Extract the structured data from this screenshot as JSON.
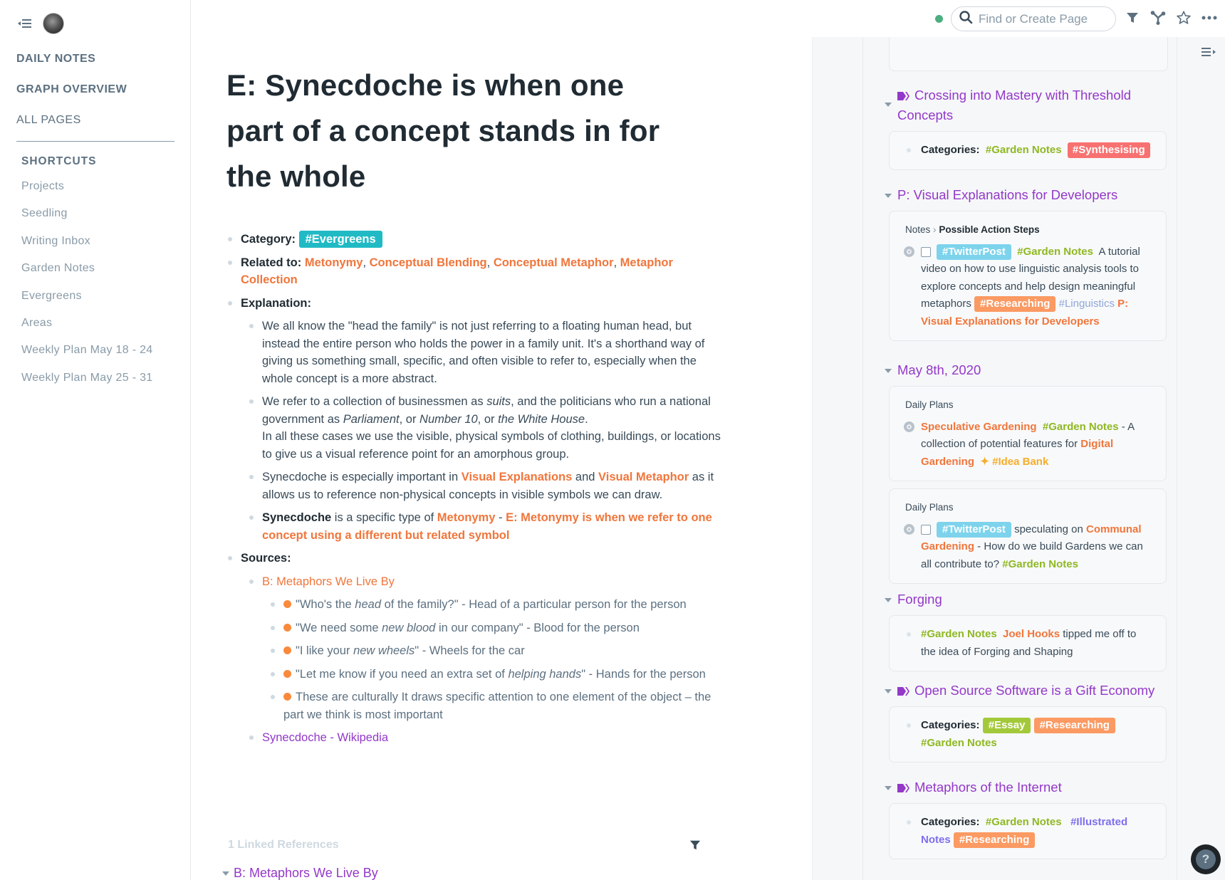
{
  "sidebar": {
    "nav": [
      "DAILY NOTES",
      "GRAPH OVERVIEW",
      "ALL PAGES"
    ],
    "shortcuts_header": "SHORTCUTS",
    "shortcuts": [
      "Projects",
      "Seedling",
      "Writing Inbox",
      "Garden Notes",
      "Evergreens",
      "Areas",
      "Weekly Plan May 18 - 24",
      "Weekly Plan May 25 - 31"
    ]
  },
  "topbar": {
    "search_placeholder": "Find or Create Page",
    "icons": [
      "filter-icon",
      "graph-icon",
      "star-icon",
      "more-icon"
    ]
  },
  "page": {
    "title": "E: Synecdoche is when one part of a concept stands in for the whole",
    "category_label": "Category:",
    "category_tag": "#Evergreens",
    "related_label": "Related to:",
    "related": [
      "Metonymy",
      "Conceptual Blending",
      "Conceptual Metaphor",
      "Metaphor Collection"
    ],
    "explanation_label": "Explanation:",
    "exp1": "We all know the \"head the family\" is not just referring to a floating human head, but instead the entire person who holds the power in a family unit. It's a shorthand way of giving us something small, specific, and often visible to refer to, especially when the whole concept is a more abstract.",
    "exp2": {
      "a": "We refer to a collection of businessmen as ",
      "b": "suits",
      "c": ", and the politicians who run a national government as ",
      "d": "Parliament",
      "e": ", or ",
      "f": "Number 10",
      "g": ", or ",
      "h": "the White House",
      "i": ".",
      "j": "In all these cases we use the visible, physical symbols of clothing, buildings, or locations to give us a visual reference point for an amorphous group."
    },
    "exp3": {
      "a": "Synecdoche is especially important in ",
      "link1": "Visual Explanations",
      "b": " and ",
      "link2": "Visual Metaphor",
      "c": " as it allows us to reference non-physical concepts in visible symbols we can draw."
    },
    "exp4": {
      "bold": "Synecdoche",
      "a": " is a specific type of ",
      "link1": "Metonymy",
      "b": " - ",
      "link2": "E: Metonymy is when we refer to one concept using a different but related symbol"
    },
    "sources_label": "Sources:",
    "source_link": "B: Metaphors We Live By",
    "examples": [
      {
        "a": "\"Who's the ",
        "i": "head",
        "b": " of the family?\" - Head of a particular person for the person"
      },
      {
        "a": "\"We need some ",
        "i": "new blood",
        "b": " in our company\" - Blood for the person"
      },
      {
        "a": "\"I like your ",
        "i": "new wheels",
        "b": "\" - Wheels for the car"
      },
      {
        "a": "\"Let me know if you need an extra set of ",
        "i": "helping hands",
        "b": "\" - Hands for the person"
      },
      {
        "a": "These are culturally It draws specific attention to one element of the object – the part we think is most important",
        "i": "",
        "b": ""
      }
    ],
    "wiki_link": "Synecdoche - Wikipedia",
    "linked_refs": "1 Linked References",
    "linked_ref_item": "B: Metaphors We Live By"
  },
  "right_panel": {
    "s1": {
      "title": "Crossing into Mastery with Threshold Concepts",
      "label": "Categories:",
      "tag1": "#Garden Notes",
      "tag2": "#Synthesising"
    },
    "s2": {
      "title": "P: Visual Explanations for Developers",
      "crumb1": "Notes",
      "crumb2": "Possible Action Steps",
      "tag_twitter": "#TwitterPost",
      "tag_garden": "#Garden Notes",
      "text": "A tutorial video on how to use linguistic analysis tools to explore concepts and help design meaningful metaphors",
      "tag_research": "#Researching",
      "tag_ling": "#Linguistics",
      "link": "P: Visual Explanations for Developers"
    },
    "s3": {
      "title": "May 8th, 2020",
      "card1": {
        "crumb": "Daily Plans",
        "link1": "Speculative Gardening",
        "tag": "#Garden Notes",
        "text": " - A collection of potential features for ",
        "link2": "Digital Gardening",
        "tag2": "✦ #Idea Bank"
      },
      "card2": {
        "crumb": "Daily Plans",
        "tag_twitter": "#TwitterPost",
        "text1": " speculating on ",
        "link": "Communal Gardening",
        "text2": " - How do we build Gardens we can all contribute to? ",
        "tag": "#Garden Notes"
      }
    },
    "s4": {
      "title": "Forging",
      "tag": "#Garden Notes",
      "link": "Joel Hooks",
      "text": " tipped me off to the idea of Forging and Shaping"
    },
    "s5": {
      "title": "Open Source Software is a Gift Economy",
      "label": "Categories:",
      "tag1": "#Essay",
      "tag2": "#Researching",
      "tag3": "#Garden Notes"
    },
    "s6": {
      "title": "Metaphors of the Internet",
      "label": "Categories:",
      "tag1": "#Garden Notes",
      "tag2": "#Illustrated Notes",
      "tag3": "#Researching"
    }
  },
  "colors": {
    "evergreens": "#20bac5",
    "synthesising": "#f87171",
    "twitter": "#7dd3ec",
    "researching": "#fb9a63",
    "essay": "#a3c93a",
    "link_orange": "#f0763c",
    "page_purple": "#9338c8"
  },
  "help_label": "?"
}
